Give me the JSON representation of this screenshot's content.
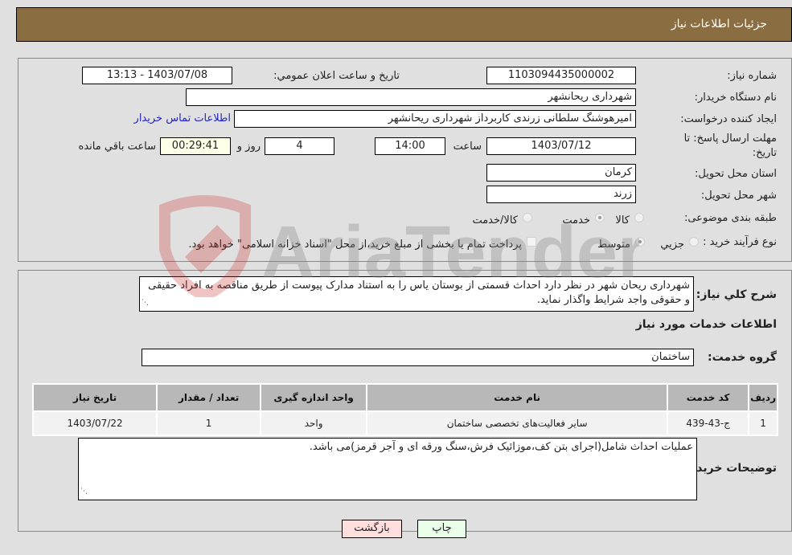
{
  "header": {
    "title": "جزئیات اطلاعات نیاز"
  },
  "form": {
    "need_number_label": "شماره نیاز:",
    "need_number": "1103094435000002",
    "announce_label": "تاریخ و ساعت اعلان عمومي:",
    "announce_value": "1403/07/08 - 13:13",
    "buyer_org_label": "نام دستگاه خریدار:",
    "buyer_org": "شهرداری ریحانشهر",
    "creator_label": "ایجاد کننده درخواست:",
    "creator": "امیرهوشنگ سلطانی زرندی کاربرداز شهرداری ریحانشهر",
    "contact_link": "اطلاعات تماس خریدار",
    "deadline_label_1": "مهلت ارسال پاسخ: تا",
    "deadline_label_2": "تاریخ:",
    "deadline_date": "1403/07/12",
    "time_label": "ساعت",
    "deadline_time": "14:00",
    "days": "4",
    "days_label": "روز و",
    "remaining": "00:29:41",
    "remaining_label": "ساعت باقي مانده",
    "province_label": "استان محل تحویل:",
    "province": "کرمان",
    "city_label": "شهر محل تحویل:",
    "city": "زرند",
    "category_label": "طبقه بندی موضوعی:",
    "category_options": [
      {
        "label": "کالا",
        "checked": false
      },
      {
        "label": "خدمت",
        "checked": true
      },
      {
        "label": "کالا/خدمت",
        "checked": false
      }
    ],
    "process_label": "نوع فرآیند خرید :",
    "process_options": [
      {
        "label": "جزيي",
        "checked": false
      },
      {
        "label": "متوسط",
        "checked": true
      }
    ],
    "treasury_note": "پرداخت تمام یا بخشی از مبلغ خرید،از محل \"اسناد خزانه اسلامی\" خواهد بود.",
    "treasury_checked": false
  },
  "details": {
    "summary_label": "شرح كلي نياز:",
    "summary_text": "شهرداری ریحان شهر در نظر دارد احداث قسمتی از بوستان یاس را به استناد مدارک پیوست از طریق مناقصه به افراد حقیقی و حقوقی واجد شرایط واگذار نماید.",
    "services_heading": "اطلاعات خدمات مورد نیاز",
    "service_group_label": "گروه خدمت:",
    "service_group": "ساختمان",
    "table": {
      "headers": [
        "ردیف",
        "کد خدمت",
        "نام خدمت",
        "واحد اندازه گیری",
        "تعداد / مقدار",
        "تاریخ نیاز"
      ],
      "rows": [
        [
          "1",
          "ج-43-439",
          "سایر فعالیت‌های تخصصی ساختمان",
          "واحد",
          "1",
          "1403/07/22"
        ]
      ]
    },
    "buyer_notes_label": "توضیحات خریدار:",
    "buyer_notes": "عملیات احداث شامل(اجرای بتن کف،موزائیک فرش،سنگ ورقه ای و آجر قرمز)می باشد."
  },
  "buttons": {
    "print": "چاپ",
    "back": "بازگشت"
  },
  "colors": {
    "header_bg": "#8b6d42",
    "print_bg": "#eaffea",
    "back_bg": "#ffdede",
    "link": "#2222cc"
  },
  "watermark": "AriaTender.neT"
}
